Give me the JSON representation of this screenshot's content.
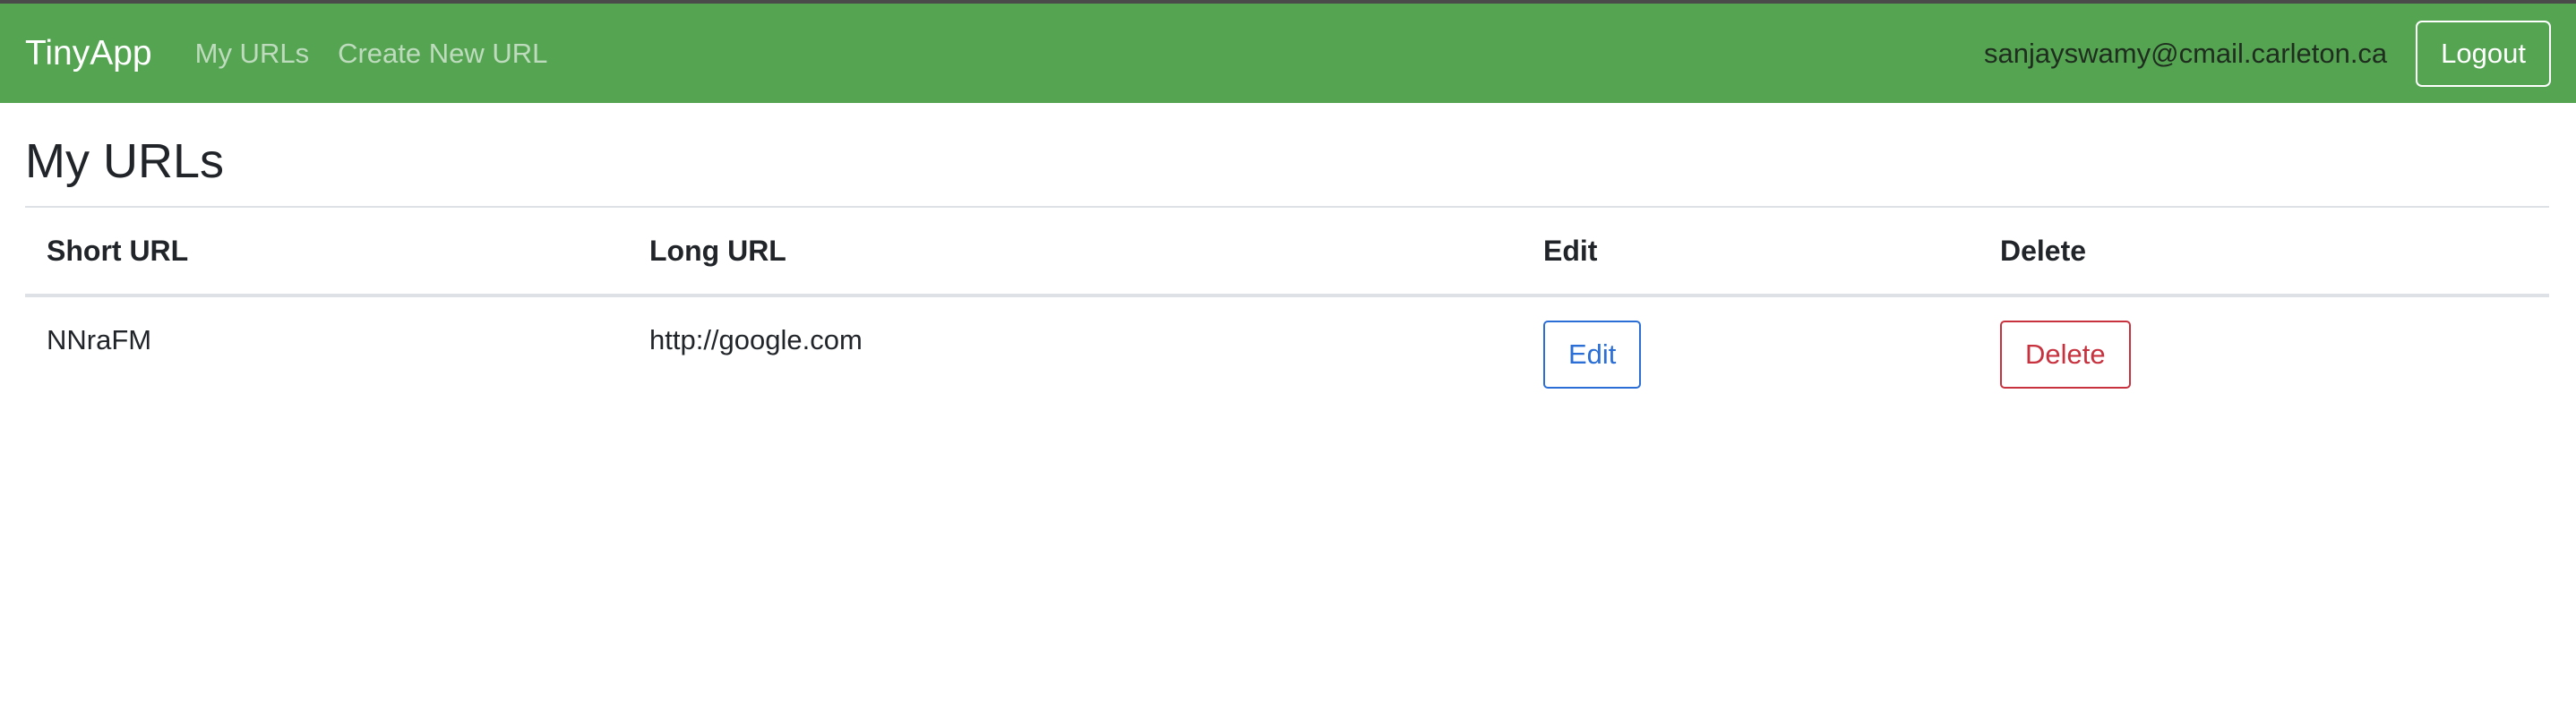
{
  "navbar": {
    "brand": "TinyApp",
    "links": [
      {
        "label": "My URLs"
      },
      {
        "label": "Create New URL"
      }
    ],
    "user_email": "sanjayswamy@cmail.carleton.ca",
    "logout_label": "Logout"
  },
  "main": {
    "title": "My URLs",
    "table": {
      "headers": [
        "Short URL",
        "Long URL",
        "Edit",
        "Delete"
      ],
      "rows": [
        {
          "short_url": "NNraFM",
          "long_url": "http://google.com",
          "edit_label": "Edit",
          "delete_label": "Delete"
        }
      ]
    }
  },
  "colors": {
    "navbar": "#54a452",
    "edit_button": "#2b6fd6",
    "delete_button": "#c8323f"
  }
}
